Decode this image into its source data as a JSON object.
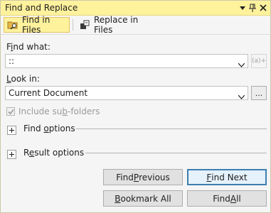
{
  "window": {
    "title": "Find and Replace"
  },
  "tabs": [
    {
      "label": "Find in Files",
      "active": true,
      "icon": "folder-find-icon"
    },
    {
      "label": "Replace in Files",
      "active": false,
      "icon": "replace-files-icon"
    }
  ],
  "find_what": {
    "label_pre": "F",
    "label_ul": "i",
    "label_post": "nd what:",
    "value": "::",
    "regex_label": "(a)+"
  },
  "look_in": {
    "label_pre": "",
    "label_ul": "L",
    "label_post": "ook in:",
    "value": "Current Document",
    "browse_label": "..."
  },
  "include_subfolders": {
    "label_pre": "Include su",
    "label_ul": "b",
    "label_post": "-folders",
    "checked": true,
    "enabled": false
  },
  "find_options": {
    "label_pre": "Find ",
    "label_ul": "o",
    "label_post": "ptions"
  },
  "result_options": {
    "label_pre": "R",
    "label_ul": "e",
    "label_post": "sult options"
  },
  "buttons": {
    "find_previous": {
      "pre": "Find ",
      "ul": "P",
      "post": "revious"
    },
    "find_next": {
      "pre": "",
      "ul": "F",
      "post": "ind Next"
    },
    "bookmark_all": {
      "pre": "",
      "ul": "B",
      "post": "ookmark All"
    },
    "find_all": {
      "pre": "Find ",
      "ul": "A",
      "post": "ll"
    }
  },
  "colors": {
    "title_bar": "#fff29d",
    "active_tab": "#fff29d",
    "default_button_border": "#3c7fb1"
  }
}
